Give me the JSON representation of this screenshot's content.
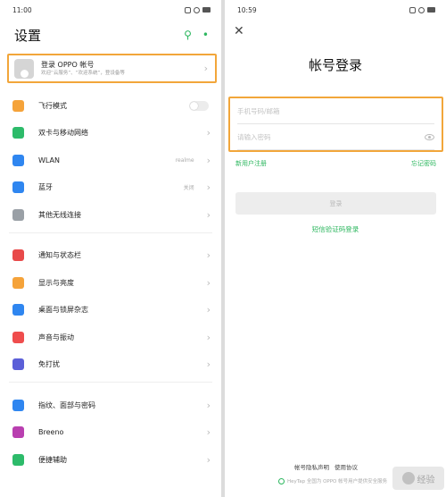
{
  "left": {
    "status": {
      "time": "11:00"
    },
    "header": {
      "title": "设置"
    },
    "account": {
      "title": "登录 OPPO 帐号",
      "subtitle": "欢迎“云服务”、“欢迎系统”，登设备等"
    },
    "groups": [
      [
        {
          "label": "飞行模式",
          "color": "#f5a33a",
          "type": "toggle"
        },
        {
          "label": "双卡与移动网络",
          "color": "#2dbb6a",
          "type": "chevron"
        },
        {
          "label": "WLAN",
          "value": "realme",
          "color": "#2f86f0",
          "type": "chevron"
        },
        {
          "label": "蓝牙",
          "value": "关闭",
          "color": "#2f86f0",
          "type": "chevron"
        },
        {
          "label": "其他无线连接",
          "color": "#9aa0a6",
          "type": "chevron"
        }
      ],
      [
        {
          "label": "通知与状态栏",
          "color": "#e84a4a",
          "type": "chevron"
        },
        {
          "label": "显示与亮度",
          "color": "#f5a33a",
          "type": "chevron"
        },
        {
          "label": "桌面与锁屏杂志",
          "color": "#2f86f0",
          "type": "chevron"
        },
        {
          "label": "声音与振动",
          "color": "#ef4d4d",
          "type": "chevron"
        },
        {
          "label": "免打扰",
          "color": "#5b5fd8",
          "type": "chevron"
        }
      ],
      [
        {
          "label": "指纹、面部与密码",
          "color": "#2f86f0",
          "type": "chevron"
        },
        {
          "label": "Breeno",
          "color": "#b93fb0",
          "type": "chevron"
        },
        {
          "label": "便捷辅助",
          "color": "#2dbb6a",
          "type": "chevron"
        }
      ]
    ]
  },
  "right": {
    "status": {
      "time": "10:59"
    },
    "title": "帐号登录",
    "phone_placeholder": "手机号码/邮箱",
    "password_placeholder": "请输入密码",
    "register_link": "新用户注册",
    "forgot_link": "忘记密码",
    "login_button": "登录",
    "sms_link": "短信验证码登录",
    "footer_links": [
      "帐号隐私声明",
      "使用协议"
    ],
    "footer_note": "HeyTap 全国为 OPPO 帐号用户提供安全服务"
  },
  "watermark": {
    "text": "经验"
  }
}
